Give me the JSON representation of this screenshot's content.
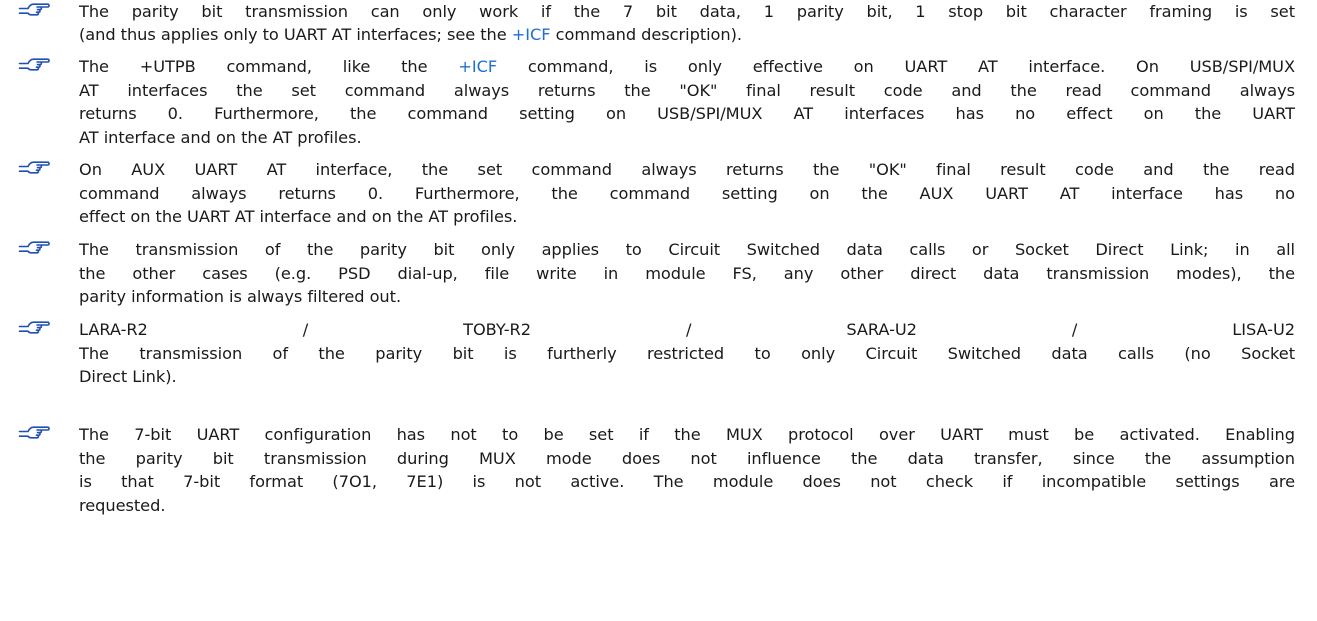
{
  "notes": [
    {
      "lines": [
        [
          "The parity bit transmission can only work if the 7 bit data, 1 parity bit, 1 stop bit character framing is set"
        ],
        [
          "(and thus applies only to UART AT interfaces; see the ",
          {
            "link": "+ICF"
          },
          " command description)."
        ]
      ]
    },
    {
      "lines": [
        [
          "The +UTPB command, like the ",
          {
            "link": "+ICF"
          },
          " command, is only effective on UART AT interface. On USB/SPI/MUX"
        ],
        [
          "AT interfaces the set command always returns the \"OK\" final result code and the read command always"
        ],
        [
          "returns 0. Furthermore, the command setting on USB/SPI/MUX AT interfaces has no effect on the UART"
        ],
        [
          "AT interface and on the AT profiles."
        ]
      ]
    },
    {
      "lines": [
        [
          "On AUX UART AT interface, the set command always returns the \"OK\" final result code and the read"
        ],
        [
          "command always returns 0. Furthermore, the command setting on the AUX UART AT interface has no"
        ],
        [
          "effect on the UART AT interface and on the AT profiles."
        ]
      ]
    },
    {
      "lines": [
        [
          "The transmission of the parity bit only applies to Circuit Switched data calls or Socket Direct Link; in all"
        ],
        [
          "the other cases (e.g. PSD dial-up, file write in module FS, any other direct data transmission modes), the"
        ],
        [
          "parity information is always filtered out."
        ]
      ]
    },
    {
      "lines": [
        [
          "LARA-R2 / TOBY-R2 / SARA-U2 / LISA-U2"
        ],
        [
          "The transmission of the parity bit is furtherly restricted to only Circuit Switched data calls (no Socket"
        ],
        [
          "Direct Link)."
        ]
      ]
    },
    {
      "lines": [
        [
          "The 7-bit UART configuration has not to be set if the MUX protocol over UART must be activated. Enabling"
        ],
        [
          "the parity bit transmission during MUX mode does not influence the data transfer, since the assumption"
        ],
        [
          "is that 7-bit format (7O1, 7E1) is not active. The module does not check if incompatible settings are"
        ],
        [
          "requested."
        ]
      ]
    }
  ],
  "icon": "pointing-hand-icon",
  "colors": {
    "text": "#1a1a1a",
    "link": "#1f6fd1",
    "icon": "#1f4fb5"
  }
}
